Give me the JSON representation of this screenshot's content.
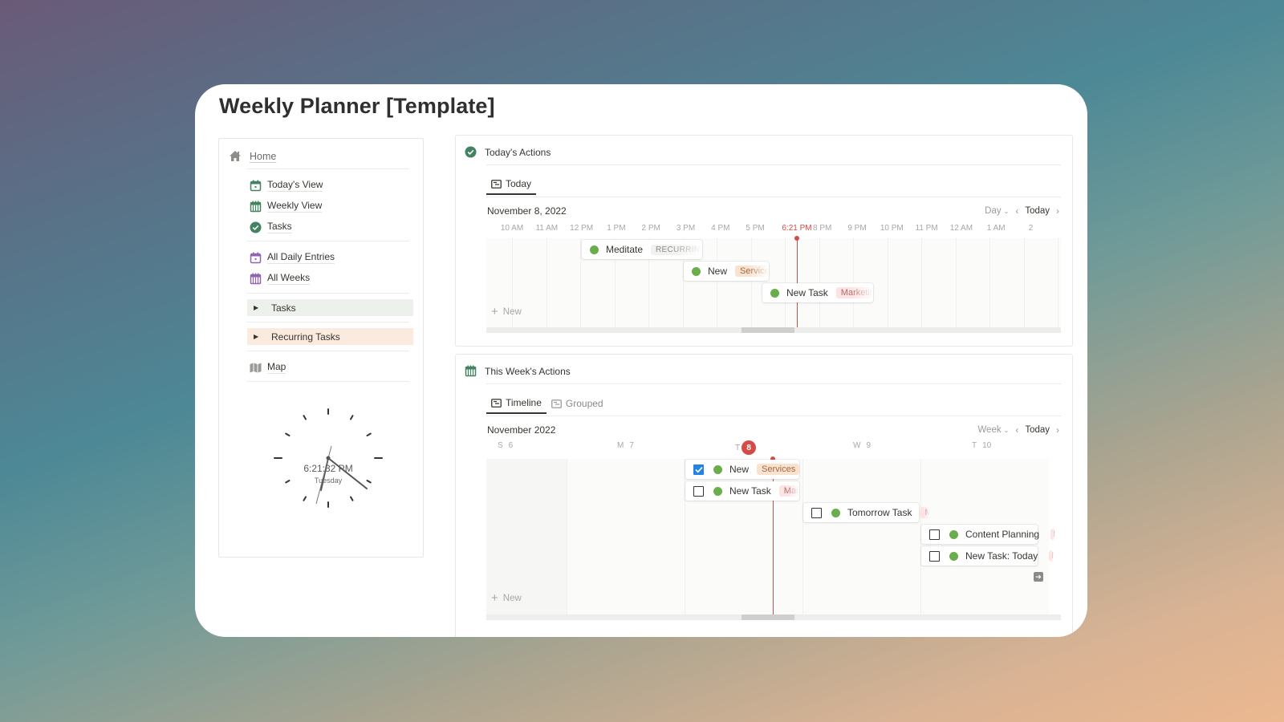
{
  "page": {
    "title": "Weekly Planner [Template]"
  },
  "sidebar": {
    "home": {
      "label": "Home",
      "icon": "home-icon"
    },
    "group1": [
      {
        "label": "Today's View",
        "icon": "calendar-day-icon",
        "color": "#448361"
      },
      {
        "label": "Weekly View",
        "icon": "calendar-week-icon",
        "color": "#448361"
      },
      {
        "label": "Tasks",
        "icon": "check-circle-icon",
        "color": "#448361"
      }
    ],
    "group2": [
      {
        "label": "All Daily Entries",
        "icon": "calendar-day-icon",
        "color": "#9065b0"
      },
      {
        "label": "All Weeks",
        "icon": "calendar-week-icon",
        "color": "#9065b0"
      }
    ],
    "toggles": [
      {
        "label": "Tasks",
        "bg": "#edf1ec"
      },
      {
        "label": "Recurring Tasks",
        "bg": "#fbebdf"
      }
    ],
    "map": {
      "label": "Map",
      "icon": "map-icon"
    },
    "clock": {
      "time": "6:21:32 PM",
      "day": "Tuesday"
    }
  },
  "today_panel": {
    "title": "Today's Actions",
    "icon": "check-circle-icon",
    "tabs": [
      {
        "label": "Today",
        "active": true
      }
    ],
    "date": "November 8, 2022",
    "mode": "Day",
    "today_label": "Today",
    "hours": [
      "10 AM",
      "11 AM",
      "12 PM",
      "1 PM",
      "2 PM",
      "3 PM",
      "4 PM",
      "5 PM",
      "6:21 PM",
      "8 PM",
      "9 PM",
      "10 PM",
      "11 PM",
      "12 AM",
      "1 AM",
      "2"
    ],
    "now_label": "6:21 PM",
    "events": [
      {
        "title": "Meditate",
        "tag": "RECURRING",
        "tag_type": "recurring"
      },
      {
        "title": "New",
        "tag": "Services",
        "tag_type": "services"
      },
      {
        "title": "New Task",
        "tag": "Marketing",
        "tag_type": "marketing"
      }
    ],
    "new_label": "New"
  },
  "week_panel": {
    "title": "This Week's Actions",
    "icon": "calendar-week-icon",
    "tabs": [
      {
        "label": "Timeline",
        "active": true
      },
      {
        "label": "Grouped",
        "active": false
      }
    ],
    "month": "November 2022",
    "mode": "Week",
    "today_label": "Today",
    "days": [
      {
        "letter": "S",
        "num": "6"
      },
      {
        "letter": "M",
        "num": "7"
      },
      {
        "letter": "T",
        "num": "8",
        "today": true
      },
      {
        "letter": "W",
        "num": "9"
      },
      {
        "letter": "T",
        "num": "10"
      }
    ],
    "events": [
      {
        "title": "New",
        "tag": "Services",
        "tag_type": "services",
        "checked": true
      },
      {
        "title": "New Task",
        "tag": "Marketing",
        "tag_type": "marketing",
        "checked": false
      },
      {
        "title": "Tomorrow Task",
        "tag": "Marketing",
        "tag_type": "marketing",
        "checked": false
      },
      {
        "title": "Content Planning",
        "tag": "M",
        "tag_type": "marketing",
        "checked": false
      },
      {
        "title": "New Task: Today",
        "tag": "M",
        "tag_type": "marketing",
        "checked": false
      }
    ],
    "new_label": "New"
  },
  "colors": {
    "now": "#d44c47",
    "status_green": "#6aad4b",
    "check_blue": "#2383e2",
    "icon_green": "#448361",
    "icon_purple": "#9065b0"
  }
}
